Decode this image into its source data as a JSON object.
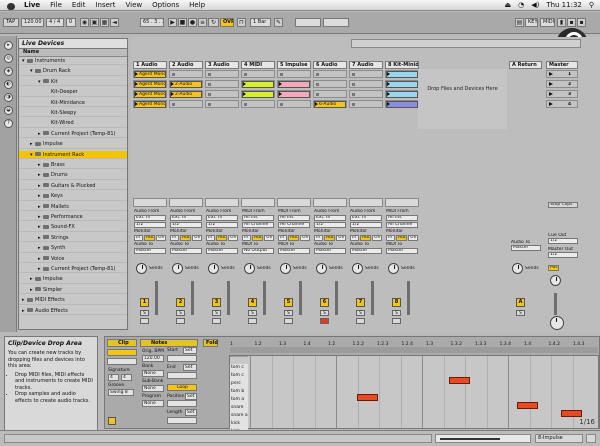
{
  "menubar": {
    "app_name": "Live",
    "menus": [
      "File",
      "Edit",
      "Insert",
      "View",
      "Options",
      "Help"
    ],
    "clock": "Thu 11:32"
  },
  "transport": {
    "tap": "TAP",
    "tempo": "120.00",
    "signature": "4 / 4",
    "off": "0",
    "position": "65 . 3 . 2",
    "quantize": "1 Bar",
    "ovr": "OVR",
    "key": "KEY",
    "midi": "MIDI"
  },
  "browser": {
    "title": "Live Devices",
    "column_header": "Name",
    "items": [
      {
        "label": "Instruments",
        "level": 0,
        "open": true,
        "folder": true,
        "selected": false
      },
      {
        "label": "Drum Rack",
        "level": 1,
        "open": true,
        "folder": true,
        "selected": false
      },
      {
        "label": "Kit",
        "level": 2,
        "open": true,
        "folder": true,
        "selected": false
      },
      {
        "label": "Kit-Deeper",
        "level": 3,
        "open": false,
        "folder": false,
        "selected": false
      },
      {
        "label": "Kit-Minidance",
        "level": 3,
        "open": false,
        "folder": false,
        "selected": false
      },
      {
        "label": "Kit-Sleepy",
        "level": 3,
        "open": false,
        "folder": false,
        "selected": false
      },
      {
        "label": "Kit-Wired",
        "level": 3,
        "open": false,
        "folder": false,
        "selected": false
      },
      {
        "label": "Current Project (Temp-81)",
        "level": 2,
        "open": false,
        "folder": true,
        "selected": false
      },
      {
        "label": "Impulse",
        "level": 1,
        "open": false,
        "folder": true,
        "selected": false
      },
      {
        "label": "Instrument Rack",
        "level": 1,
        "open": true,
        "folder": true,
        "selected": true
      },
      {
        "label": "Brass",
        "level": 2,
        "open": false,
        "folder": true,
        "selected": false
      },
      {
        "label": "Drums",
        "level": 2,
        "open": false,
        "folder": true,
        "selected": false
      },
      {
        "label": "Guitars & Plucked",
        "level": 2,
        "open": false,
        "folder": true,
        "selected": false
      },
      {
        "label": "Keys",
        "level": 2,
        "open": false,
        "folder": true,
        "selected": false
      },
      {
        "label": "Mallets",
        "level": 2,
        "open": false,
        "folder": true,
        "selected": false
      },
      {
        "label": "Performance",
        "level": 2,
        "open": false,
        "folder": true,
        "selected": false
      },
      {
        "label": "Sound-FX",
        "level": 2,
        "open": false,
        "folder": true,
        "selected": false
      },
      {
        "label": "Strings",
        "level": 2,
        "open": false,
        "folder": true,
        "selected": false
      },
      {
        "label": "Synth",
        "level": 2,
        "open": false,
        "folder": true,
        "selected": false
      },
      {
        "label": "Voice",
        "level": 2,
        "open": false,
        "folder": true,
        "selected": false
      },
      {
        "label": "Current Project (Temp-81)",
        "level": 2,
        "open": false,
        "folder": true,
        "selected": false
      },
      {
        "label": "Impulse",
        "level": 1,
        "open": false,
        "folder": true,
        "selected": false
      },
      {
        "label": "Simpler",
        "level": 1,
        "open": false,
        "folder": true,
        "selected": false
      },
      {
        "label": "MIDI Effects",
        "level": 0,
        "open": false,
        "folder": true,
        "selected": false
      },
      {
        "label": "Audio Effects",
        "level": 0,
        "open": false,
        "folder": true,
        "selected": false
      }
    ]
  },
  "session": {
    "tracks": [
      {
        "name": "1 Audio",
        "number": "1",
        "clips": [
          "Agent Mono",
          "Agent Mono",
          "Agent Mono",
          "Agent Mono"
        ],
        "clip_colors": [
          "#f3c41a",
          "#f3c41a",
          "#f3c41a",
          "#f3c41a"
        ]
      },
      {
        "name": "2 Audio",
        "number": "2",
        "clips": [
          "",
          "2-Audio",
          "2-Audio",
          ""
        ],
        "clip_colors": [
          "",
          "#f3c41a",
          "#f3c41a",
          ""
        ]
      },
      {
        "name": "3 Audio",
        "number": "3",
        "clips": [
          "",
          "",
          "",
          ""
        ],
        "clip_colors": [
          "",
          "",
          "",
          ""
        ]
      },
      {
        "name": "4 MIDI",
        "number": "4",
        "clips": [
          "",
          "",
          "",
          ""
        ],
        "clip_colors": [
          "",
          "#d7f02a",
          "#d7f02a",
          ""
        ]
      },
      {
        "name": "5 Impulse",
        "number": "5",
        "clips": [
          "",
          "",
          "",
          ""
        ],
        "clip_colors": [
          "",
          "#f5a8b8",
          "#f5a8b8",
          ""
        ]
      },
      {
        "name": "6 Audio",
        "number": "6",
        "clips": [
          "",
          "",
          "",
          "6-Audio"
        ],
        "clip_colors": [
          "",
          "",
          "",
          "#f3c41a"
        ]
      },
      {
        "name": "7 Audio",
        "number": "7",
        "clips": [
          "",
          "",
          "",
          ""
        ],
        "clip_colors": [
          "",
          "",
          "",
          ""
        ]
      },
      {
        "name": "8 Kit-Minid",
        "number": "8",
        "clips": [
          "",
          "",
          "",
          ""
        ],
        "clip_colors": [
          "#9ad6f2",
          "#9ad6f2",
          "#9ad6f2",
          "#8c8ce0"
        ]
      }
    ],
    "drop_zone": "Drop Files and Devices Here",
    "return_track": {
      "name": "A Return",
      "letter": "A"
    },
    "master": {
      "name": "Master",
      "scenes": [
        "1",
        "2",
        "3",
        "4"
      ],
      "stop_clips": "Stop Clips",
      "cue_out": "Cue Out",
      "master_out": "Master Out",
      "cue_value": "1/2",
      "out_value": "1/2",
      "post": "Post"
    },
    "io": {
      "audio_from": "Audio From",
      "midi_from": "MIDI From",
      "ext_in": "Ext. In",
      "all_ins": "All Ins",
      "channel": "1/2",
      "all_channels": "All Channe",
      "monitor": "Monitor",
      "in": "In",
      "auto": "Auto",
      "off": "Off",
      "audio_to": "Audio To",
      "midi_to": "MIDI To",
      "master": "Master",
      "no_output": "No Output",
      "sends": "Sends",
      "s": "S"
    }
  },
  "info_box": {
    "title": "Clip/Device Drop Area",
    "paragraph": "You can create new tracks by dropping files and devices into this area:",
    "bullets": [
      "Drop MIDI files, MIDI effects and instruments to create MIDI tracks.",
      "Drop samples and audio effects to create audio tracks."
    ]
  },
  "clip_view": {
    "clip_tab": "Clip",
    "notes_tab": "Notes",
    "fold": "Fold",
    "signature_label": "Signature",
    "signature_num": "4",
    "signature_den": "4",
    "groove_label": "Groove",
    "groove_value": "Swing 8",
    "bank_label": "Bank",
    "bank_value": "None",
    "subbank_label": "Sub-Bank",
    "subbank_value": "None",
    "program_label": "Program",
    "program_value": "None",
    "orig_bpm_label": "Orig. BPM",
    "orig_bpm": "120.00",
    "start_label": "Start",
    "start": "Set",
    "end_label": "End",
    "end": "Set",
    "loop": "Loop",
    "position_label": "Position",
    "position": "Set",
    "length_label": "Length",
    "length": "Set",
    "ruler": [
      "1",
      "1.2",
      "1.3",
      "1.4",
      "1.2",
      "1.2.2",
      "1.2.3",
      "1.2.4",
      "1.3",
      "1.3.2",
      "1.3.3",
      "1.3.4",
      "1.4",
      "1.4.2",
      "1.4.3"
    ],
    "keys": [
      "",
      "tom c",
      "tom c",
      "perc",
      "tom b",
      "tom a",
      "snare",
      "snare a",
      "kick",
      "kick"
    ],
    "grid": "1/16"
  },
  "status": {
    "mode": "8-Impulse"
  },
  "colors": {
    "selection": "#f5c400",
    "accent": "#e1c32a",
    "note": "#e64b22"
  }
}
